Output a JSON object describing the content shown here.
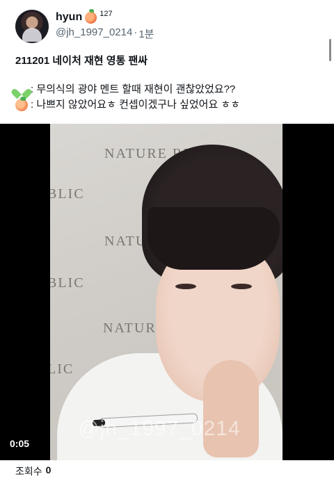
{
  "user": {
    "display_name": "hyun",
    "badge_count": "127",
    "handle": "@jh_1997_0214",
    "separator": "·",
    "time_ago": "1분"
  },
  "post": {
    "title": "211201 네이처 재현 영통 팬싸",
    "lines": [
      {
        "icon": "green-heart-icon",
        "text": ": 무의식의 광야 멘트 할때 재현이 괜찮았었요??"
      },
      {
        "icon": "peach-icon",
        "text": ": 나쁘지 않았어요ㅎ 컨셉이겠구나 싶었어요 ㅎㅎ"
      }
    ]
  },
  "video": {
    "wall_texts": [
      "NATURE RE",
      "BLIC",
      "NATU",
      "BLIC",
      "NATURE",
      "LIC"
    ],
    "watermark": "@jh_1997_0214",
    "timestamp": "0:05"
  },
  "footer": {
    "views_label": "조회수",
    "views_count": "0"
  },
  "colors": {
    "text": "#0f1419",
    "muted": "#536471",
    "background": "#ffffff",
    "video_bg": "#000000"
  }
}
